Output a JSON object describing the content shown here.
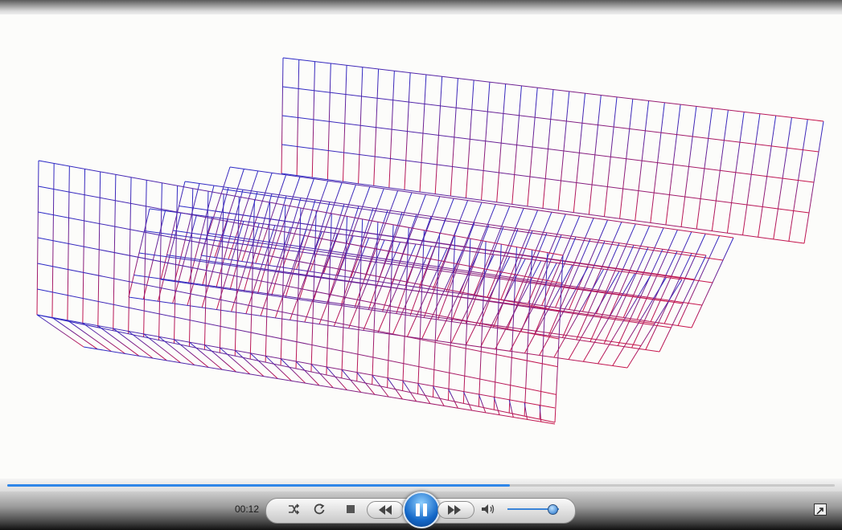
{
  "player": {
    "time": "00:12",
    "progress_fraction": 0.607,
    "volume_fraction": 0.88,
    "state": "playing"
  },
  "icons": {
    "shuffle": "shuffle-icon",
    "repeat": "repeat-icon",
    "stop": "stop-icon",
    "previous": "rewind-icon",
    "pause": "pause-icon",
    "next": "fast-forward-icon",
    "volume": "speaker-icon",
    "fullscreen": "fullscreen-icon"
  },
  "colors": {
    "wire_top": "#2a2ac8",
    "wire_bottom": "#c8144a",
    "progress": "#2f86e8"
  }
}
